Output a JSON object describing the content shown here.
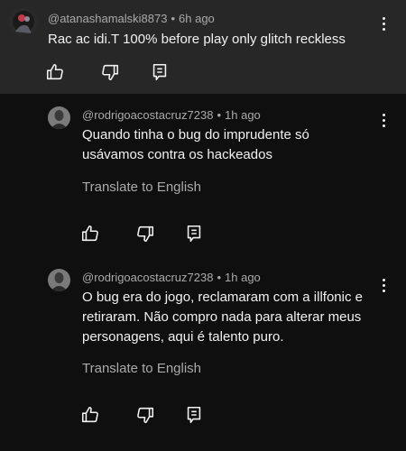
{
  "parent_comment": {
    "handle": "@atanashamalski8873",
    "time": "6h ago",
    "text": "Rac ac idi.T 100% before play only glitch reckless"
  },
  "replies": [
    {
      "handle": "@rodrigoacostacruz7238",
      "time": "1h ago",
      "text": "Quando tinha o bug do imprudente só usávamos contra os hackeados",
      "translate_label": "Translate to English"
    },
    {
      "handle": "@rodrigoacostacruz7238",
      "time": "1h ago",
      "text": "O bug era do jogo, reclamaram com a illfonic e retiraram. Não compro nada para alterar meus personagens, aqui é talento puro.",
      "translate_label": "Translate to English"
    }
  ],
  "separator": "•",
  "icons": {
    "like": "thumbs-up-icon",
    "dislike": "thumbs-down-icon",
    "reply": "reply-icon",
    "menu": "more-vertical-icon"
  },
  "colors": {
    "background": "#0f0f0f",
    "parent_background": "#272727",
    "secondary_text": "#aaaaaa",
    "primary_text": "#f1f1f1"
  }
}
